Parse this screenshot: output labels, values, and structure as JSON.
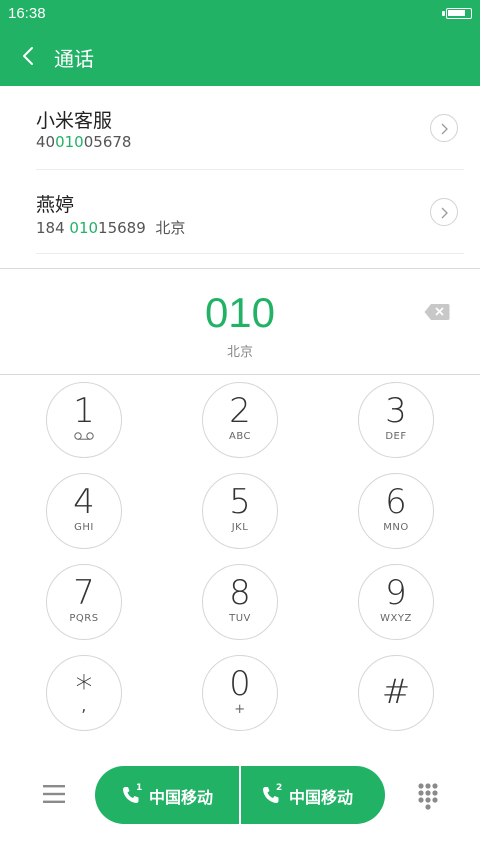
{
  "status_bar": {
    "time": "16:38",
    "battery_level": 0.85
  },
  "header": {
    "title": "通话"
  },
  "results": [
    {
      "name": "小米客服",
      "number_before": "40",
      "number_match": "010",
      "number_after": "05678",
      "location": ""
    },
    {
      "name": "燕婷",
      "number_before": "184 ",
      "number_match": "010",
      "number_after": "15689",
      "location": "北京"
    }
  ],
  "dialer": {
    "input": "010",
    "location": "北京"
  },
  "keypad": [
    {
      "digit": "1",
      "letters": ""
    },
    {
      "digit": "2",
      "letters": "ABC"
    },
    {
      "digit": "3",
      "letters": "DEF"
    },
    {
      "digit": "4",
      "letters": "GHI"
    },
    {
      "digit": "5",
      "letters": "JKL"
    },
    {
      "digit": "6",
      "letters": "MNO"
    },
    {
      "digit": "7",
      "letters": "PQRS"
    },
    {
      "digit": "8",
      "letters": "TUV"
    },
    {
      "digit": "9",
      "letters": "WXYZ"
    },
    {
      "digit": "*",
      "letters": ","
    },
    {
      "digit": "0",
      "letters": "+"
    },
    {
      "digit": "#",
      "letters": ""
    }
  ],
  "call_buttons": [
    {
      "sim": "1",
      "carrier": "中国移动"
    },
    {
      "sim": "2",
      "carrier": "中国移动"
    }
  ],
  "colors": {
    "accent": "#21b266"
  },
  "icons": {
    "back": "back-arrow-icon",
    "backspace": "backspace-icon",
    "menu": "menu-icon",
    "dialpad": "dialpad-icon",
    "voicemail": "voicemail-icon",
    "phone": "phone-icon"
  }
}
